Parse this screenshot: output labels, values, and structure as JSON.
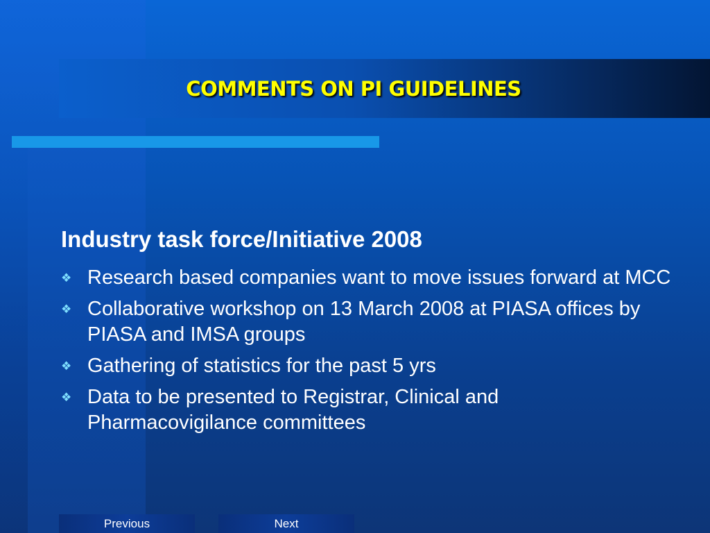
{
  "slide": {
    "title": "COMMENTS ON PI GUIDELINES",
    "subtitle": "Industry task force/Initiative 2008",
    "bullets": [
      "Research based companies want to move issues forward at MCC",
      "Collaborative workshop on 13 March 2008 at PIASA offices by PIASA and IMSA groups",
      "Gathering of statistics for the past 5 yrs",
      "Data to be presented to Registrar, Clinical and Pharmacovigilance committees"
    ],
    "bullet_icon": "diamond-bullet-icon",
    "bullet_glyph": "❖"
  },
  "navigation": {
    "previous_label": "Previous",
    "next_label": "Next"
  },
  "colors": {
    "background": "#0753b5",
    "title": "#ffff00",
    "accent_bar": "#1898e8",
    "bullet": "#7fe0ff",
    "text": "#ffffff"
  }
}
